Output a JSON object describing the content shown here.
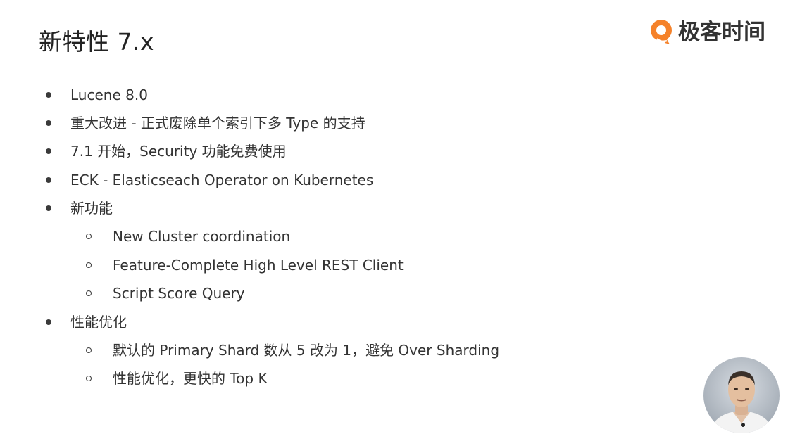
{
  "slide": {
    "title": "新特性 7.x"
  },
  "brand": {
    "name": "极客时间",
    "logo_icon": "geektime-logo-icon",
    "accent_color": "#f5822a"
  },
  "bullets": [
    {
      "text": "Lucene 8.0"
    },
    {
      "text": "重大改进 - 正式废除单个索引下多 Type 的支持"
    },
    {
      "text": "7.1 开始，Security 功能免费使用"
    },
    {
      "text": "ECK - Elasticseach Operator on Kubernetes"
    },
    {
      "text": "新功能"
    },
    {
      "text": "New Cluster coordination"
    },
    {
      "text": "Feature-Complete High Level REST Client"
    },
    {
      "text": "Script Score Query"
    },
    {
      "text": "性能优化"
    },
    {
      "text": "默认的 Primary Shard 数从 5 改为 1，避免 Over Sharding"
    },
    {
      "text": "性能优化，更快的 Top K"
    }
  ],
  "presenter": {
    "icon": "presenter-webcam-icon"
  }
}
